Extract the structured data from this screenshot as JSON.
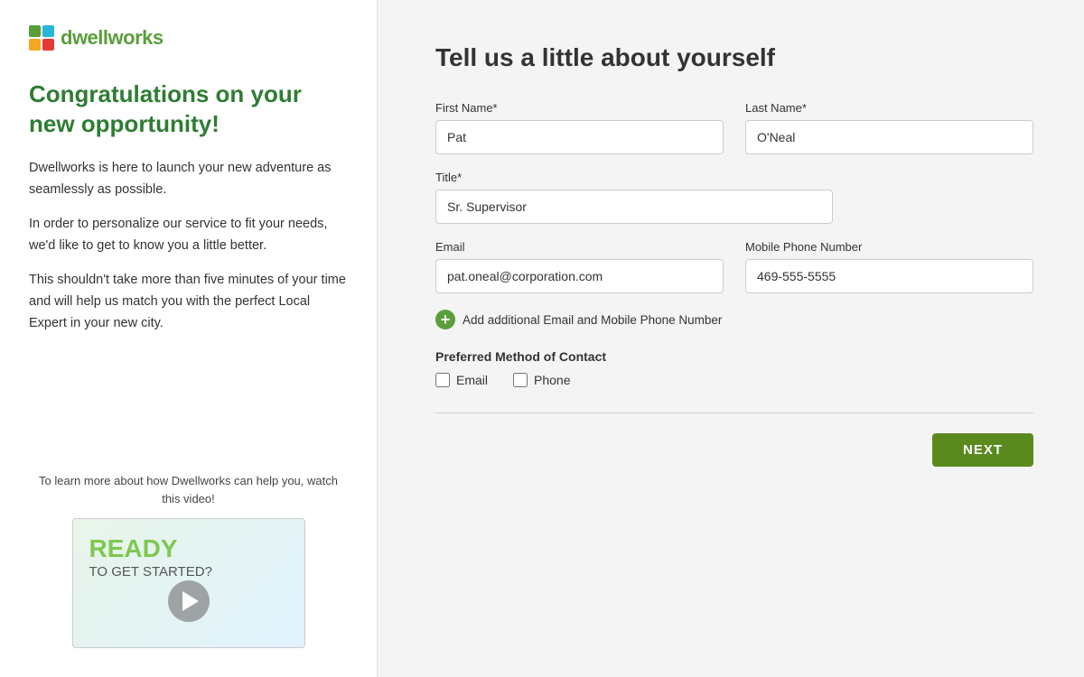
{
  "logo": {
    "name_prefix": "dwell",
    "name_suffix": "works"
  },
  "left": {
    "congrats_heading": "Congratulations on your new opportunity!",
    "para1": "Dwellworks is here to launch your new adventure as seamlessly as possible.",
    "para2": "In order to personalize our service to fit your needs, we'd like to get to know you a little better.",
    "para3": "This shouldn't take more than five minutes of your time and will help us match you with the perfect Local Expert in your new city.",
    "video_prompt": "To learn more about how Dwellworks can help you, watch this video!",
    "video_line1": "READY",
    "video_line2": "TO GET STARTED?"
  },
  "right": {
    "form_title": "Tell us a little about yourself",
    "fields": {
      "first_name_label": "First Name*",
      "first_name_value": "Pat",
      "last_name_label": "Last Name*",
      "last_name_value": "O'Neal",
      "title_label": "Title*",
      "title_value": "Sr. Supervisor",
      "email_label": "Email",
      "email_value": "pat.oneal@corporation.com",
      "phone_label": "Mobile Phone Number",
      "phone_value": "469-555-5555"
    },
    "add_contact": "Add additional Email and Mobile Phone Number",
    "preferred_contact": {
      "label": "Preferred Method of Contact",
      "email_label": "Email",
      "phone_label": "Phone"
    },
    "next_button": "NEXT"
  }
}
